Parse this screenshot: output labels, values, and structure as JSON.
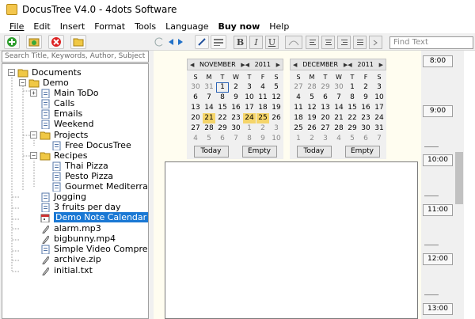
{
  "window": {
    "title": "DocusTree V4.0 - 4dots Software"
  },
  "menu": [
    "File",
    "Edit",
    "Insert",
    "Format",
    "Tools",
    "Language",
    "Buy now",
    "Help"
  ],
  "toolbar": {
    "buttons": [
      "add-icon",
      "refresh-icon",
      "delete-icon",
      "folder-icon"
    ],
    "format_buttons": [
      "B",
      "I",
      "U"
    ],
    "find_placeholder": "Find Text"
  },
  "sidebar": {
    "search_placeholder": "Search Title,  Keywords, Author, Subject",
    "tree": [
      {
        "label": "Documents",
        "type": "folder"
      },
      {
        "label": "Demo",
        "type": "folder"
      },
      {
        "label": "Main ToDo",
        "type": "doc"
      },
      {
        "label": "Calls",
        "type": "doc"
      },
      {
        "label": "Emails",
        "type": "doc"
      },
      {
        "label": "Weekend",
        "type": "doc"
      },
      {
        "label": "Projects",
        "type": "folder"
      },
      {
        "label": "Free DocusTree",
        "type": "doc"
      },
      {
        "label": "Recipes",
        "type": "folder"
      },
      {
        "label": "Thai Pizza",
        "type": "doc"
      },
      {
        "label": "Pesto Pizza",
        "type": "doc"
      },
      {
        "label": "Gourmet Mediterranean",
        "type": "doc"
      },
      {
        "label": "Jogging",
        "type": "doc"
      },
      {
        "label": "3 fruits per day",
        "type": "doc"
      },
      {
        "label": "Demo Note Calendar",
        "type": "doc"
      },
      {
        "label": "alarm.mp3",
        "type": "file"
      },
      {
        "label": "bigbunny.mp4",
        "type": "file"
      },
      {
        "label": "Simple Video Compressor I",
        "type": "file"
      },
      {
        "label": "archive.zip",
        "type": "file"
      },
      {
        "label": "initial.txt",
        "type": "file"
      }
    ],
    "selected_index": 14
  },
  "calendars": [
    {
      "month": "NOVEMBER",
      "year": "2011",
      "dow": [
        "S",
        "M",
        "T",
        "W",
        "T",
        "F",
        "S"
      ],
      "weeks": [
        [
          "30",
          "31",
          "1",
          "2",
          "3",
          "4",
          "5"
        ],
        [
          "6",
          "7",
          "8",
          "9",
          "10",
          "11",
          "12"
        ],
        [
          "13",
          "14",
          "15",
          "16",
          "17",
          "18",
          "19"
        ],
        [
          "20",
          "21",
          "22",
          "23",
          "24",
          "25",
          "26"
        ],
        [
          "27",
          "28",
          "29",
          "30",
          "1",
          "2",
          "3"
        ],
        [
          "4",
          "5",
          "6",
          "7",
          "8",
          "9",
          "10"
        ]
      ],
      "today": "Today",
      "empty": "Empty"
    },
    {
      "month": "DECEMBER",
      "year": "2011",
      "dow": [
        "S",
        "M",
        "T",
        "W",
        "T",
        "F",
        "S"
      ],
      "weeks": [
        [
          "27",
          "28",
          "29",
          "30",
          "1",
          "2",
          "3"
        ],
        [
          "4",
          "5",
          "6",
          "7",
          "8",
          "9",
          "10"
        ],
        [
          "11",
          "12",
          "13",
          "14",
          "15",
          "16",
          "17"
        ],
        [
          "18",
          "19",
          "20",
          "21",
          "22",
          "23",
          "24"
        ],
        [
          "25",
          "26",
          "27",
          "28",
          "29",
          "30",
          "31"
        ],
        [
          "1",
          "2",
          "3",
          "4",
          "5",
          "6",
          "7"
        ]
      ],
      "today": "Today",
      "empty": "Empty"
    }
  ],
  "times": [
    "8:00",
    "9:00",
    "10:00",
    "11:00",
    "12:00",
    "13:00"
  ],
  "colors": {
    "selection": "#1a78d4",
    "highlight": "#f5d56a",
    "note_bg": "#fffdf0"
  }
}
